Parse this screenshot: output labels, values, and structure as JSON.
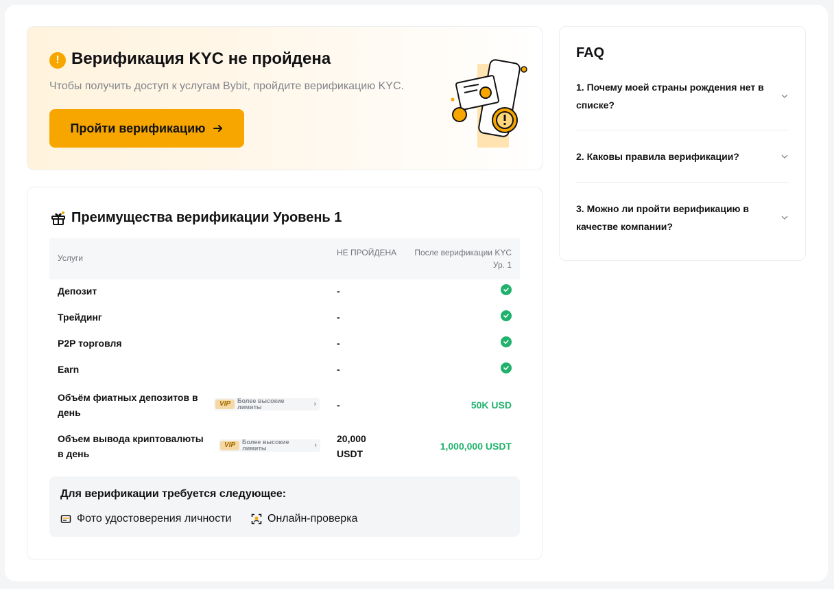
{
  "banner": {
    "title": "Верификация KYC не пройдена",
    "subtitle": "Чтобы получить доступ к услугам Bybit, пройдите верификацию KYC.",
    "button_label": "Пройти верификацию",
    "warn_symbol": "!"
  },
  "benefits": {
    "title": "Преимущества верификации Уровень 1",
    "headers": {
      "service": "Услуги",
      "not_passed": "НЕ ПРОЙДЕНА",
      "after": "После верификации KYC Ур. 1"
    },
    "rows": [
      {
        "service": "Депозит",
        "before": "-",
        "after_icon": "check-icon"
      },
      {
        "service": "Трейдинг",
        "before": "-",
        "after_icon": "check-icon"
      },
      {
        "service": "P2P торговля",
        "before": "-",
        "after_icon": "check-icon"
      },
      {
        "service": "Earn",
        "before": "-",
        "after_icon": "check-icon"
      },
      {
        "service": "Объём фиатных депозитов в день",
        "vip_tag": "VIP",
        "vip_text": "Более высокие лимиты",
        "before": "-",
        "after": "50K USD"
      },
      {
        "service": "Объем вывода криптовалюты в день",
        "vip_tag": "VIP",
        "vip_text": "Более высокие лимиты",
        "before": "20,000 USDT",
        "after": "1,000,000 USDT"
      }
    ],
    "requirements": {
      "title": "Для верификации требуется следующее:",
      "items": [
        "Фото удостоверения личности",
        "Онлайн-проверка"
      ]
    }
  },
  "faq": {
    "title": "FAQ",
    "items": [
      "1. Почему моей страны рождения нет в списке?",
      "2. Каковы правила верификации?",
      "3. Можно ли пройти верификацию в качестве компании?"
    ]
  },
  "colors": {
    "accent": "#f7a600",
    "success": "#20b26c",
    "banner_bg": "#fff3dd"
  }
}
